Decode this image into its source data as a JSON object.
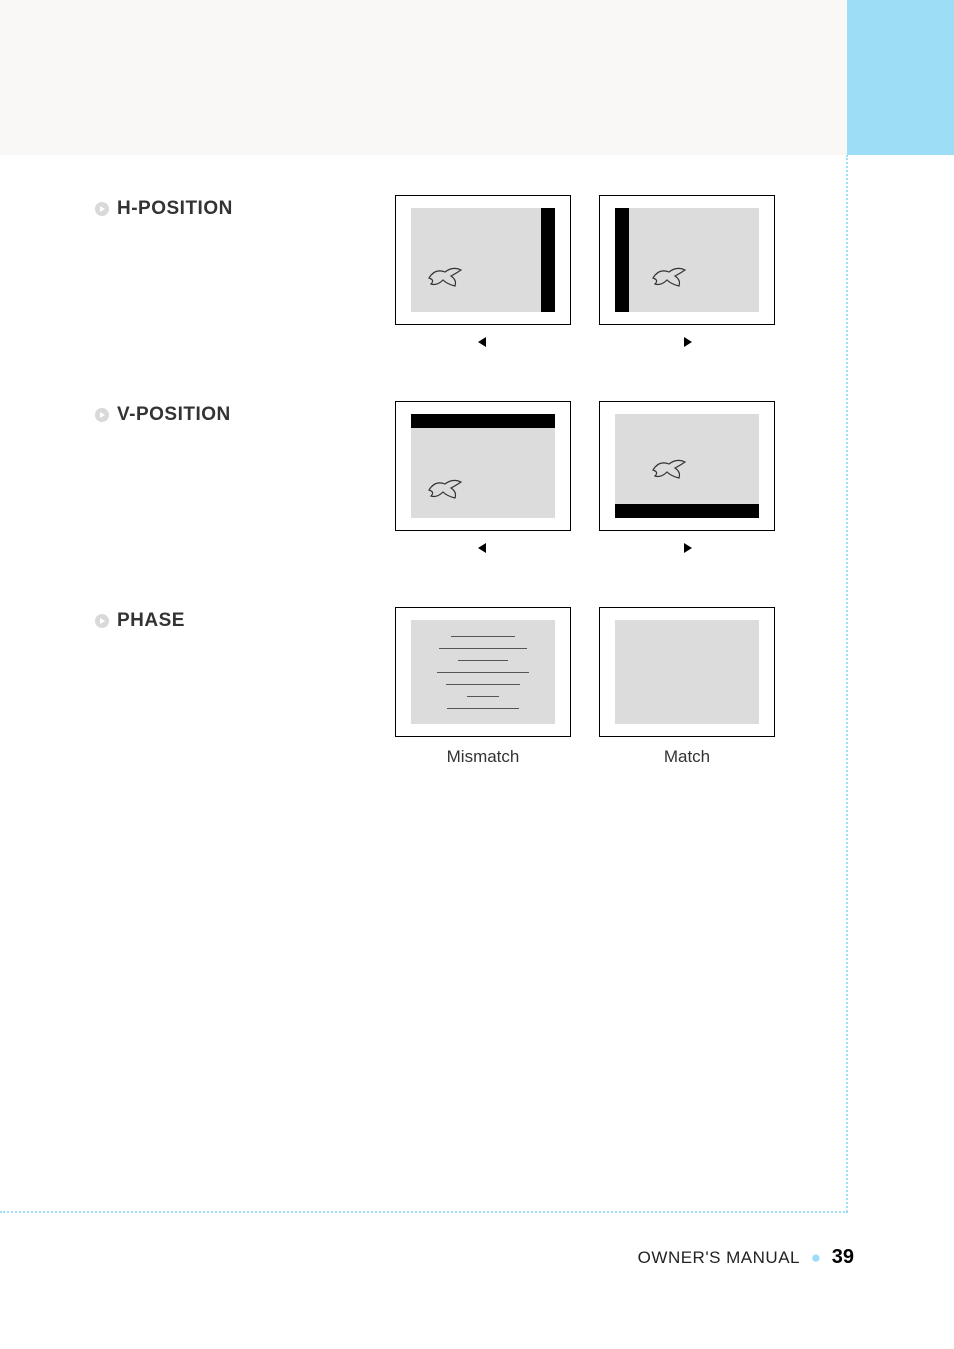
{
  "sections": {
    "hpos": {
      "label": "H-POSITION"
    },
    "vpos": {
      "label": "V-POSITION"
    },
    "phase": {
      "label": "PHASE",
      "mismatch": "Mismatch",
      "match": "Match"
    }
  },
  "footer": {
    "title": "OWNER'S MANUAL",
    "page": "39"
  }
}
